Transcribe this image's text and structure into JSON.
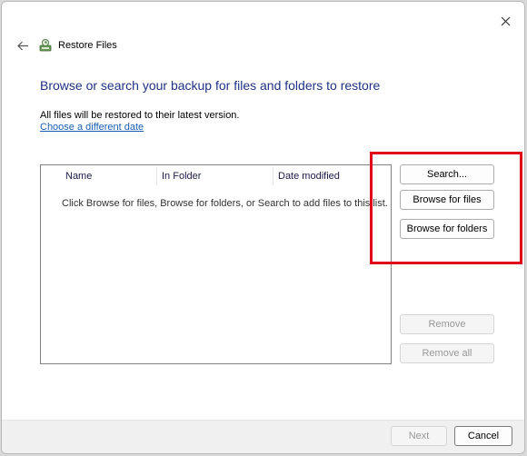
{
  "window": {
    "title": "Restore Files"
  },
  "icons": {
    "close": "close-icon",
    "back": "arrow-left-icon",
    "app": "restore-files-icon"
  },
  "content": {
    "heading": "Browse or search your backup for files and folders to restore",
    "info": "All files will be restored to their latest version.",
    "date_link": "Choose a different date"
  },
  "file_list": {
    "columns": [
      "Name",
      "In Folder",
      "Date modified"
    ],
    "empty_message": "Click Browse for files, Browse for folders, or Search to add files to this list."
  },
  "buttons": {
    "search": "Search...",
    "browse_files": "Browse for files",
    "browse_folders": "Browse for folders",
    "remove": "Remove",
    "remove_all": "Remove all",
    "next": "Next",
    "cancel": "Cancel"
  },
  "colors": {
    "heading": "#1e3287",
    "link": "#1a5fb4",
    "highlight": "#e0001a"
  }
}
